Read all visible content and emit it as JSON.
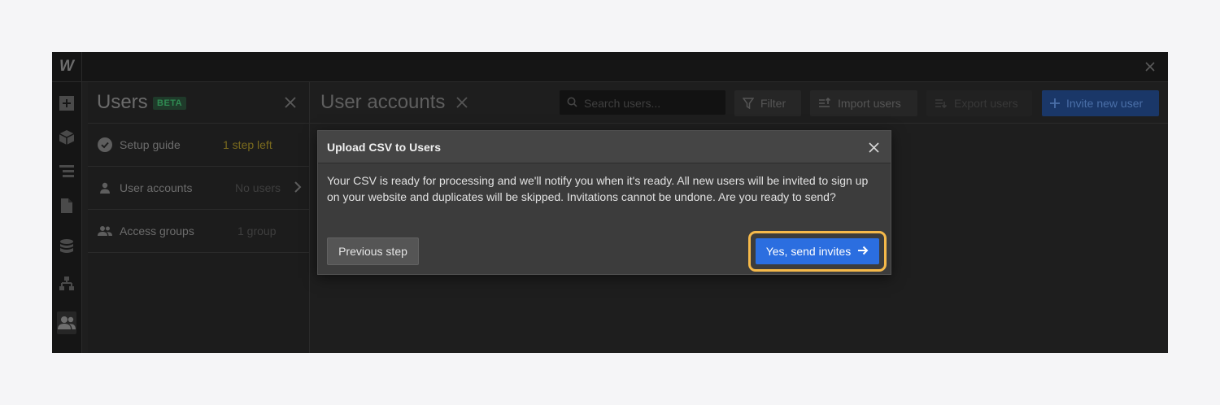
{
  "app": {
    "logo": "W"
  },
  "rail": {
    "icons": [
      "add-icon",
      "box-icon",
      "navigator-icon",
      "page-icon",
      "database-icon",
      "logic-icon",
      "users-icon"
    ]
  },
  "panel": {
    "title": "Users",
    "badge": "BETA",
    "rows": [
      {
        "label": "Setup guide",
        "sub": "1 step left"
      },
      {
        "label": "User accounts",
        "sub": "No users"
      },
      {
        "label": "Access groups",
        "sub": "1 group"
      }
    ]
  },
  "main": {
    "title": "User accounts",
    "search_placeholder": "Search users...",
    "filter_label": "Filter",
    "import_label": "Import users",
    "export_label": "Export users",
    "invite_label": "Invite new user"
  },
  "modal": {
    "title": "Upload CSV to Users",
    "body": "Your CSV is ready for processing and we'll notify you when it's ready. All new users will be invited to sign up on your website and duplicates will be skipped. Invitations cannot be undone. Are you ready to send?",
    "previous_label": "Previous step",
    "send_label": "Yes, send invites"
  },
  "colors": {
    "primary": "#2b6ee0",
    "highlight": "#f5b94a",
    "beta_badge": "#2f8a52",
    "warning_text": "#7a6a1e"
  }
}
